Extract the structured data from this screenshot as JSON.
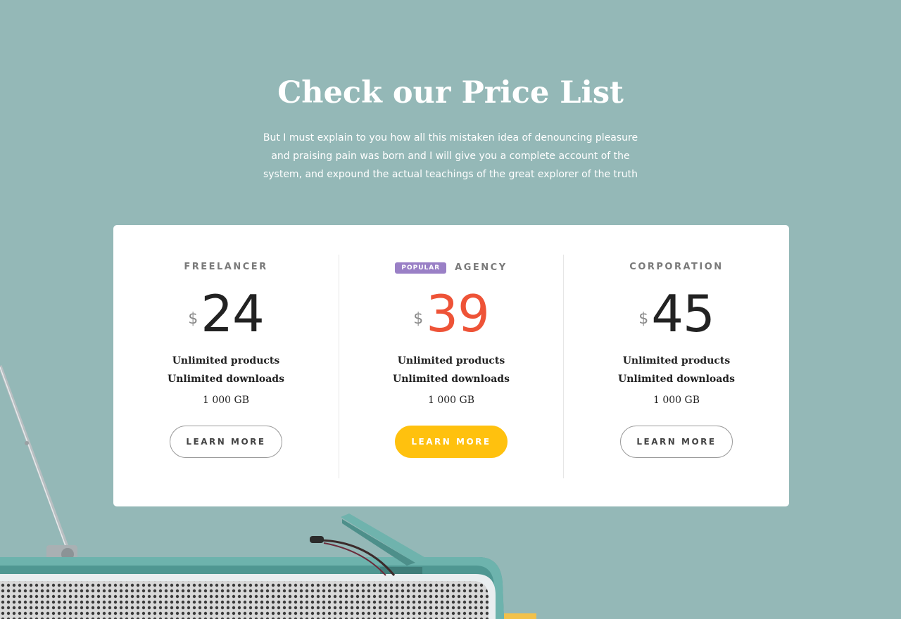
{
  "header": {
    "title": "Check our Price List",
    "subtitle": "But I must explain to you how all this mistaken idea of denouncing pleasure and praising pain was born and I will give you a complete account of the system, and expound the actual teachings of the great explorer of the truth"
  },
  "plans": [
    {
      "name": "FREELANCER",
      "currency": "$",
      "price": "24",
      "features": [
        "Unlimited products",
        "Unlimited downloads"
      ],
      "storage": "1 000 GB",
      "button": "LEARN MORE"
    },
    {
      "badge": "POPULAR",
      "name": "AGENCY",
      "currency": "$",
      "price": "39",
      "features": [
        "Unlimited products",
        "Unlimited downloads"
      ],
      "storage": "1 000 GB",
      "button": "LEARN MORE"
    },
    {
      "name": "CORPORATION",
      "currency": "$",
      "price": "45",
      "features": [
        "Unlimited products",
        "Unlimited downloads"
      ],
      "storage": "1 000 GB",
      "button": "LEARN MORE"
    }
  ],
  "colors": {
    "background": "#94b8b7",
    "highlight_price": "#ee5337",
    "primary_button": "#ffc10e",
    "badge": "#9a80c6"
  },
  "icons": {
    "illustration": "retro-radio-image"
  }
}
